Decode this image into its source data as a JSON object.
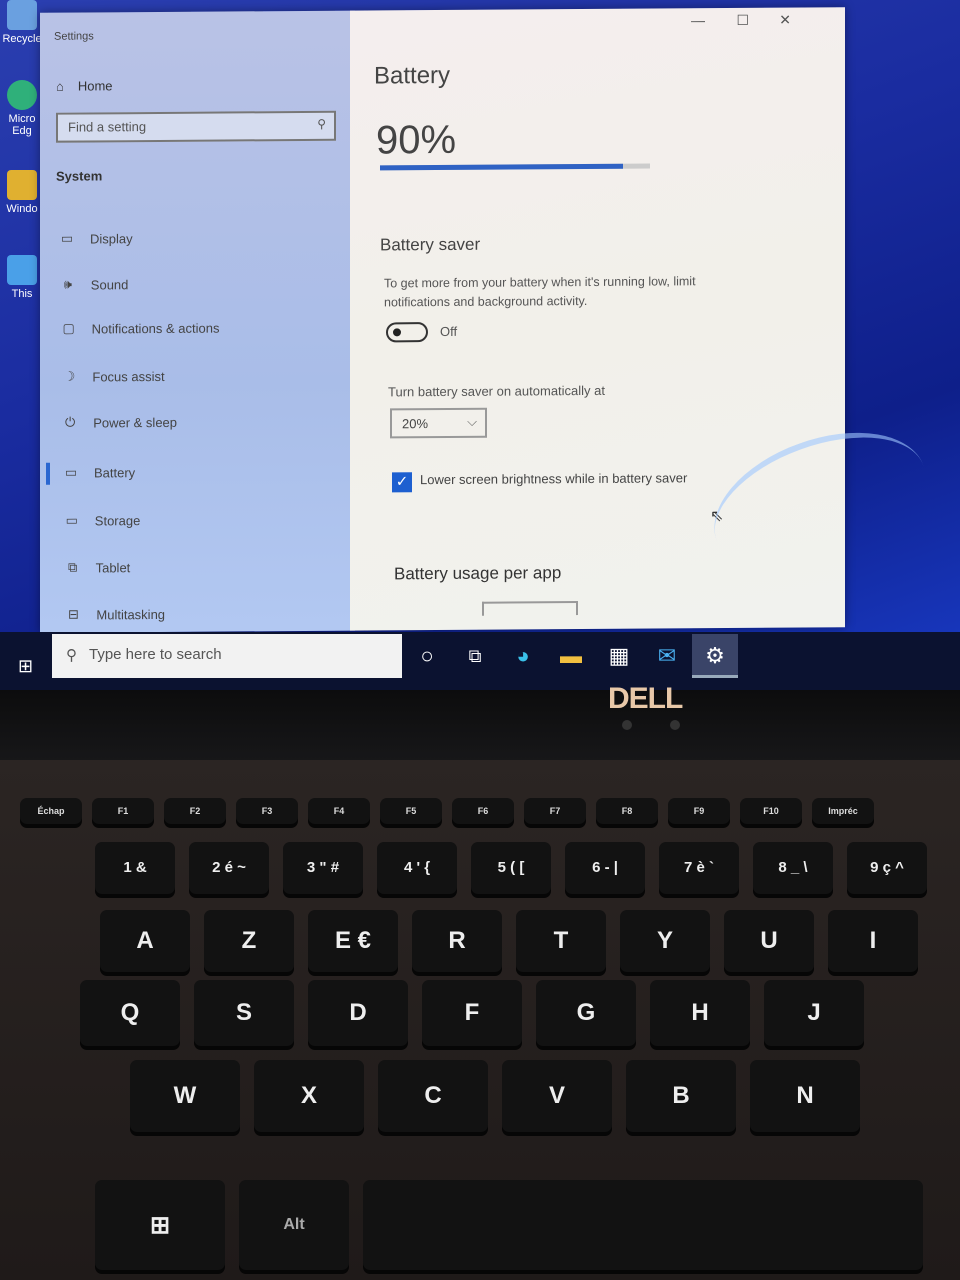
{
  "desktop": {
    "icons": [
      {
        "label": "Recycle",
        "color": "#6aa0e0"
      },
      {
        "label": "Micro Edg",
        "color": "#2fb07a"
      },
      {
        "label": "Windo",
        "color": "#e0b030"
      },
      {
        "label": "This",
        "color": "#4aa0e8"
      }
    ]
  },
  "window": {
    "title": "Settings",
    "controls": {
      "minimize": "—",
      "maximize": "☐",
      "close": "✕"
    }
  },
  "sidebar": {
    "home": "Home",
    "search_placeholder": "Find a setting",
    "section": "System",
    "items": [
      {
        "label": "Display",
        "icon": "▭"
      },
      {
        "label": "Sound",
        "icon": "🕪"
      },
      {
        "label": "Notifications & actions",
        "icon": "▢"
      },
      {
        "label": "Focus assist",
        "icon": "☽"
      },
      {
        "label": "Power & sleep",
        "icon": "⏻"
      },
      {
        "label": "Battery",
        "icon": "▭",
        "selected": true
      },
      {
        "label": "Storage",
        "icon": "▭"
      },
      {
        "label": "Tablet",
        "icon": "⧉"
      },
      {
        "label": "Multitasking",
        "icon": "⊟"
      }
    ]
  },
  "main": {
    "title": "Battery",
    "percent_label": "90%",
    "percent": 90,
    "accent": "#2f62c4",
    "saver": {
      "heading": "Battery saver",
      "description": "To get more from your battery when it's running low, limit notifications and background activity.",
      "toggle_state": "Off",
      "auto_label": "Turn battery saver on automatically at",
      "auto_value": "20%",
      "checkbox_label": "Lower screen brightness while in battery saver",
      "checkbox_checked": true
    },
    "usage_heading": "Battery usage per app"
  },
  "taskbar": {
    "search_placeholder": "Type here to search",
    "apps": [
      "cortana",
      "task-view",
      "edge",
      "file-explorer",
      "store",
      "mail",
      "settings"
    ]
  },
  "bezel": {
    "logo": "DELL"
  },
  "keyboard": {
    "fn": [
      "Échap",
      "F1",
      "F2",
      "F3",
      "F4",
      "F5",
      "F6",
      "F7",
      "F8",
      "F9",
      "F10",
      "Impréc"
    ],
    "num": [
      "1 &",
      "2 é ~",
      "3 \" #",
      "4 ' {",
      "5 ( [",
      "6 - |",
      "7 è `",
      "8 _ \\",
      "9 ç ^"
    ],
    "row1": [
      "A",
      "Z",
      "E €",
      "R",
      "T",
      "Y",
      "U",
      "I"
    ],
    "row2": [
      "Q",
      "S",
      "D",
      "F",
      "G",
      "H",
      "J"
    ],
    "row3": [
      "W",
      "X",
      "C",
      "V",
      "B",
      "N"
    ],
    "row4": [
      "⊞",
      "Alt"
    ]
  }
}
